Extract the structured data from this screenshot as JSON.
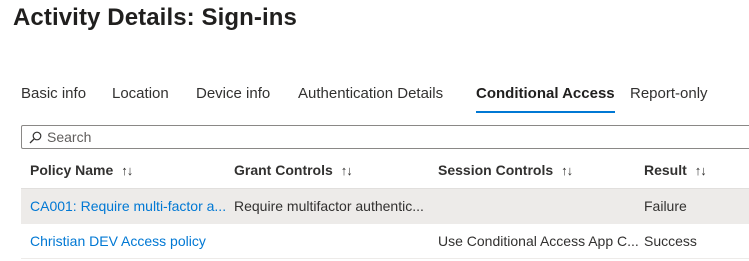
{
  "page": {
    "title": "Activity Details: Sign-ins"
  },
  "tabs": [
    {
      "label": "Basic info"
    },
    {
      "label": "Location"
    },
    {
      "label": "Device info"
    },
    {
      "label": "Authentication Details"
    },
    {
      "label": "Conditional Access",
      "active": true
    },
    {
      "label": "Report-only"
    }
  ],
  "search": {
    "placeholder": "Search",
    "value": ""
  },
  "table": {
    "columns": [
      {
        "label": "Policy Name",
        "sort_icon": "↑↓"
      },
      {
        "label": "Grant Controls",
        "sort_icon": "↑↓"
      },
      {
        "label": "Session Controls",
        "sort_icon": "↑↓"
      },
      {
        "label": "Result",
        "sort_icon": "↑↓"
      }
    ],
    "rows": [
      {
        "policy_name": "CA001: Require multi-factor a...",
        "grant_controls": "Require multifactor authentic...",
        "session_controls": "",
        "result": "Failure",
        "selected": true
      },
      {
        "policy_name": "Christian DEV Access policy",
        "grant_controls": "",
        "session_controls": "Use Conditional Access App C...",
        "result": "Success",
        "selected": false
      }
    ]
  },
  "colors": {
    "accent": "#0078d4",
    "selected_row": "#edebe9"
  }
}
